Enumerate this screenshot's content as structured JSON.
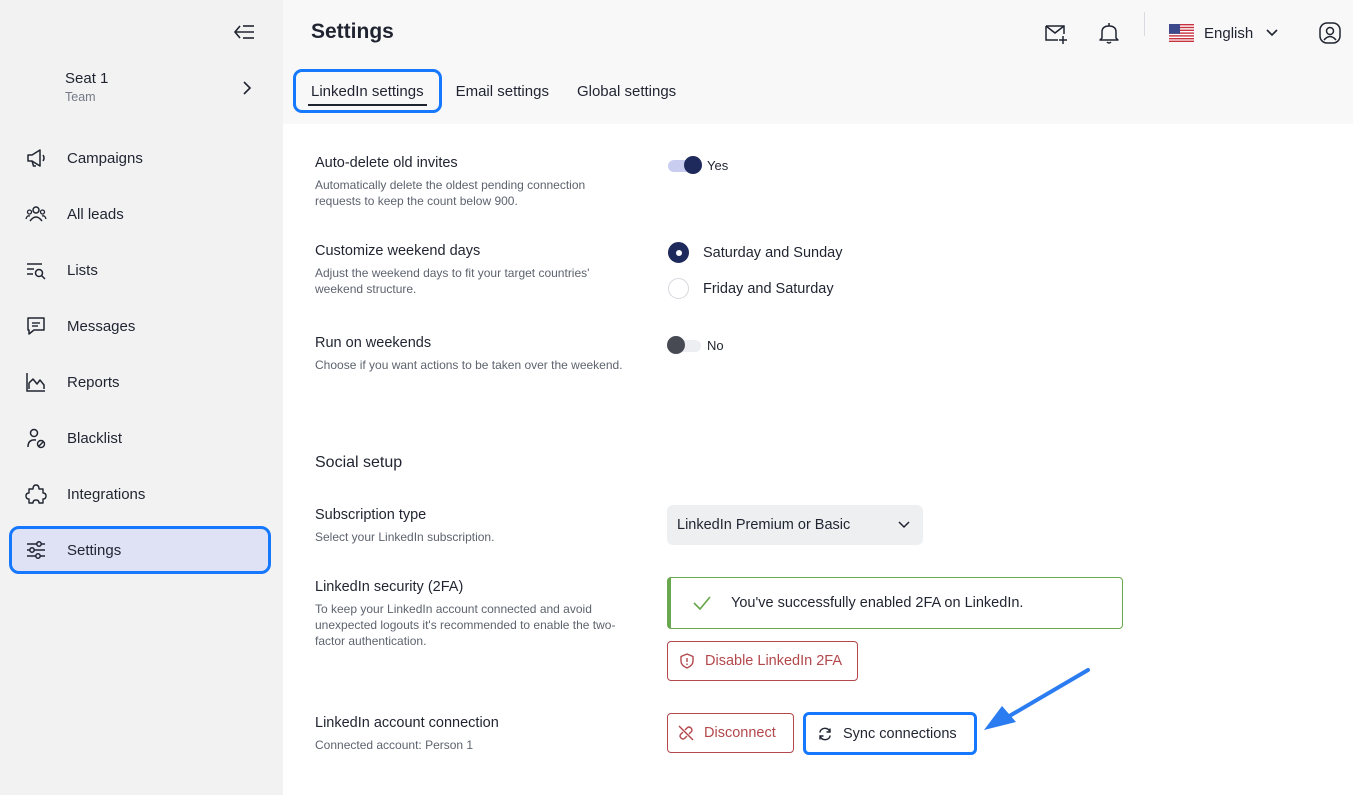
{
  "sidebar": {
    "seat_name": "Seat 1",
    "seat_sub": "Team",
    "items": [
      {
        "label": "Campaigns",
        "icon": "megaphone-icon"
      },
      {
        "label": "All leads",
        "icon": "users-icon"
      },
      {
        "label": "Lists",
        "icon": "list-search-icon"
      },
      {
        "label": "Messages",
        "icon": "message-icon"
      },
      {
        "label": "Reports",
        "icon": "chart-icon"
      },
      {
        "label": "Blacklist",
        "icon": "user-block-icon"
      },
      {
        "label": "Integrations",
        "icon": "puzzle-icon"
      },
      {
        "label": "Settings",
        "icon": "sliders-icon",
        "active": true
      }
    ]
  },
  "header": {
    "title": "Settings",
    "language": "English",
    "tabs": [
      {
        "label": "LinkedIn settings",
        "active": true
      },
      {
        "label": "Email settings"
      },
      {
        "label": "Global settings"
      }
    ]
  },
  "settings": {
    "auto_delete": {
      "title": "Auto-delete old invites",
      "desc": "Automatically delete the oldest pending connection requests to keep the count below 900.",
      "value": "Yes",
      "enabled": true
    },
    "weekend_days": {
      "title": "Customize weekend days",
      "desc": "Adjust the weekend days to fit your target countries' weekend structure.",
      "options": [
        "Saturday and Sunday",
        "Friday and Saturday"
      ],
      "selected": "Saturday and Sunday"
    },
    "run_weekends": {
      "title": "Run on weekends",
      "desc": "Choose if you want actions to be taken over the weekend.",
      "value": "No",
      "enabled": false
    }
  },
  "social": {
    "section_title": "Social setup",
    "subscription": {
      "title": "Subscription type",
      "desc": "Select your LinkedIn subscription.",
      "value": "LinkedIn Premium or Basic"
    },
    "security": {
      "title": "LinkedIn security (2FA)",
      "desc": "To keep your LinkedIn account connected and avoid unexpected logouts it's recommended to enable the two-factor authentication.",
      "success_msg": "You've successfully enabled 2FA on LinkedIn.",
      "disable_label": "Disable LinkedIn 2FA"
    },
    "connection": {
      "title": "LinkedIn account connection",
      "desc": "Connected account: Person 1",
      "disconnect_label": "Disconnect",
      "sync_label": "Sync connections"
    }
  },
  "colors": {
    "accent_highlight": "#1677ff",
    "navy": "#1f2a5c",
    "danger": "#b3484c",
    "success": "#6aa84f"
  }
}
